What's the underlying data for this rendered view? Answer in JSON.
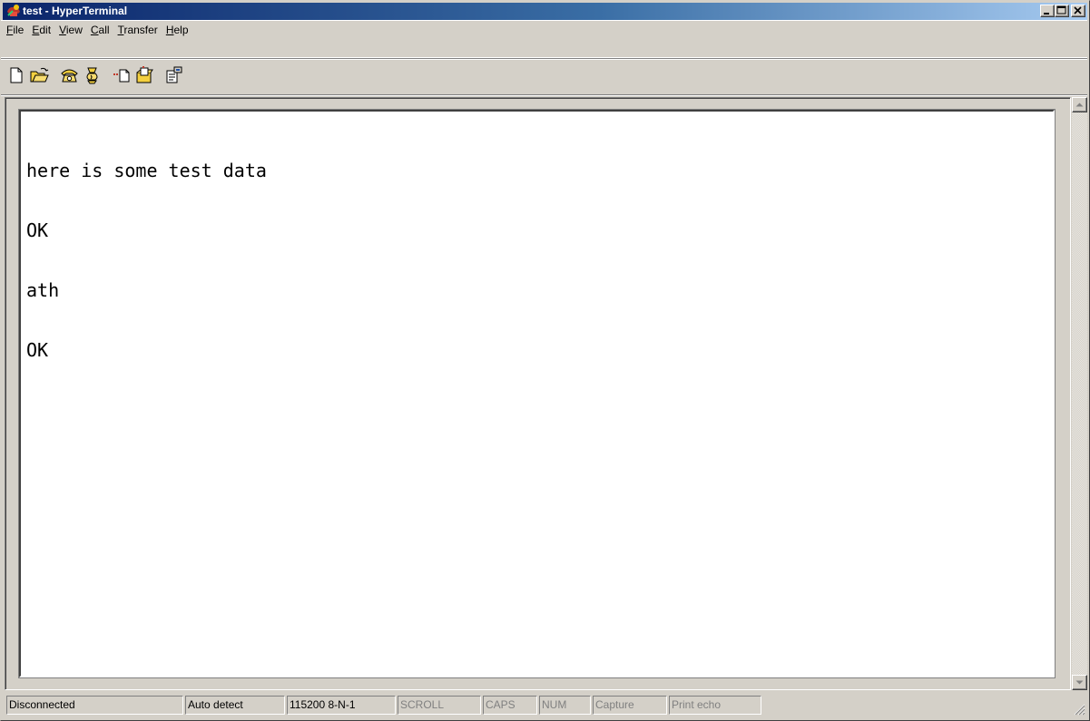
{
  "window": {
    "title": "test - HyperTerminal",
    "colors": {
      "titlebar_start": "#0a246a",
      "titlebar_end": "#a6caf0",
      "face": "#d4d0c8"
    }
  },
  "title_buttons": [
    {
      "name": "minimize-icon"
    },
    {
      "name": "maximize-icon"
    },
    {
      "name": "close-icon"
    }
  ],
  "menu": [
    {
      "accel": "F",
      "rest": "ile"
    },
    {
      "accel": "E",
      "rest": "dit"
    },
    {
      "accel": "V",
      "rest": "iew"
    },
    {
      "accel": "C",
      "rest": "all"
    },
    {
      "accel": "T",
      "rest": "ransfer"
    },
    {
      "accel": "H",
      "rest": "elp"
    }
  ],
  "toolbar": [
    {
      "icon": "new-document-icon"
    },
    {
      "icon": "open-folder-icon"
    },
    {
      "icon": "connect-phone-icon"
    },
    {
      "icon": "disconnect-phone-icon"
    },
    {
      "icon": "send-file-icon"
    },
    {
      "icon": "receive-file-icon"
    },
    {
      "icon": "properties-icon"
    }
  ],
  "terminal": {
    "lines": [
      "here is some test data",
      "OK",
      "ath",
      "OK"
    ]
  },
  "status": {
    "connection": "Disconnected",
    "detect": "Auto detect",
    "port_settings": "115200 8-N-1",
    "scroll": "SCROLL",
    "caps": "CAPS",
    "num": "NUM",
    "capture": "Capture",
    "print_echo": "Print echo"
  }
}
